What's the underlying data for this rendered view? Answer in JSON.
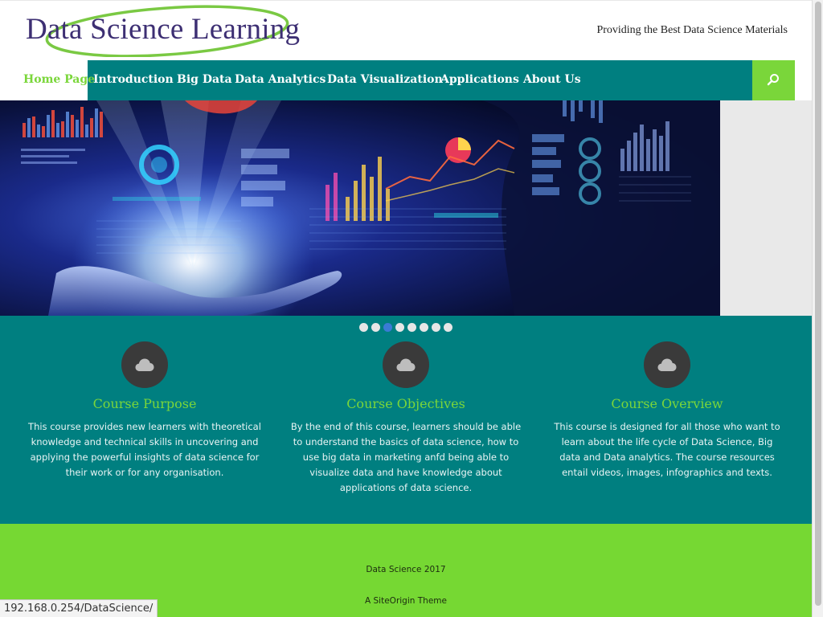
{
  "site": {
    "logo_text": "Data Science Learning",
    "tagline": "Providing the Best Data Science Materials"
  },
  "nav": {
    "items": [
      {
        "label": "Home Page",
        "active": true
      },
      {
        "label": "Introduction",
        "active": false
      },
      {
        "label": "Big Data",
        "active": false
      },
      {
        "label": "Data Analytics",
        "active": false
      },
      {
        "label": "Data Visualization",
        "active": false
      },
      {
        "label": "Applications",
        "active": false
      },
      {
        "label": "About Us",
        "active": false
      }
    ],
    "search_icon": "search-icon"
  },
  "slider": {
    "dot_count": 8,
    "active_dot": 3
  },
  "features": [
    {
      "icon": "cloud-icon",
      "title": "Course Purpose",
      "text": "This course provides new learners with theoretical knowledge and technical skills in uncovering and applying the powerful insights of data science for their work or for any organisation."
    },
    {
      "icon": "cloud-icon",
      "title": "Course Objectives",
      "text": "By the end of this course, learners should be able to understand the basics of data science, how to use big data in marketing anfd being able to visualize data and have knowledge about applications of data science."
    },
    {
      "icon": "cloud-icon",
      "title": "Course Overview",
      "text": "This course is designed for all those who want to learn about the life cycle of Data Science, Big data and Data analytics. The course resources entail videos, images, infographics and texts."
    }
  ],
  "footer": {
    "copyright": "Data Science 2017",
    "theme_credit": "A SiteOrigin Theme"
  },
  "status_bar": {
    "url": "192.168.0.254/DataScience/"
  },
  "colors": {
    "teal": "#007f80",
    "green": "#7ad63a",
    "logo_purple": "#3d2f73",
    "active_dot": "#3a7bd5"
  }
}
